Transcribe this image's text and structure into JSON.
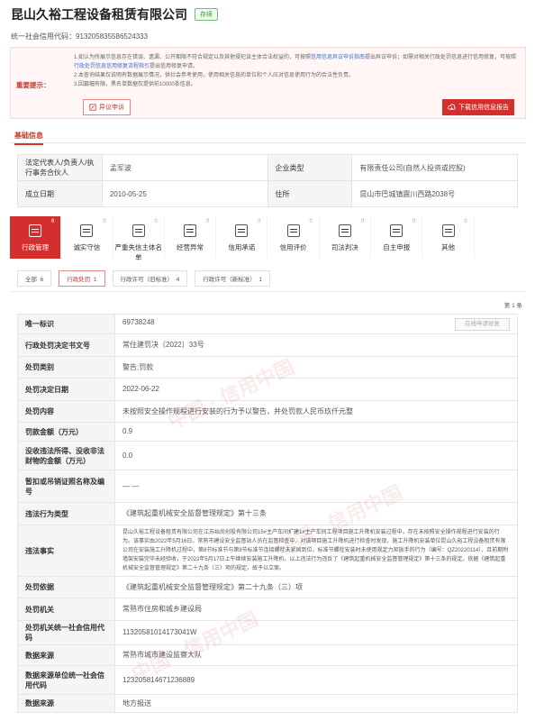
{
  "header": {
    "company_name": "昆山久裕工程设备租赁有限公司",
    "status": "存续",
    "credit_code": "统一社会信用代码：913205835586524333"
  },
  "notice": {
    "label": "重要提示：",
    "line1_a": "1.如认为所展示信息存在错误、遗漏、公开期限不符合规定以及其他侵犯该主体合法权益的，可按照",
    "line1_link1": "信用信息异议申诉指南",
    "line1_b": "提出异议申诉；如需对相关行政处罚信息进行信用修复，可按照",
    "line1_link2": "行政处罚信息信用修复流程指引",
    "line1_c": "提出信用修复申请。",
    "line2": "2.本查询结果仅说明有数据展示情况，供社会参考使用，使用相关信息的单位和个人应对信息使用行为的合法性负责。",
    "line3": "3.因篇幅有限，黑名单数据仅提供前10000条信息。",
    "objection_btn": "异议申诉",
    "download_btn": "下载信用信息报告"
  },
  "basic": {
    "tab": "基础信息",
    "legal_rep_label": "法定代表人/负责人/执行事务合伙人",
    "legal_rep_value": "孟军波",
    "type_label": "企业类型",
    "type_value": "有限责任公司(自然人投资或控股)",
    "date_label": "成立日期",
    "date_value": "2010-05-25",
    "address_label": "住所",
    "address_value": "昆山市巴城镇震川西路2038号"
  },
  "categories": [
    {
      "label": "行政管理",
      "count": "6",
      "icon": "admin-icon"
    },
    {
      "label": "诚实守信",
      "count": "0",
      "icon": "honesty-icon"
    },
    {
      "label": "严重失信主体名单",
      "count": "0",
      "icon": "blacklist-icon"
    },
    {
      "label": "经营异常",
      "count": "0",
      "icon": "alarm-icon"
    },
    {
      "label": "信用承诺",
      "count": "0",
      "icon": "promise-icon"
    },
    {
      "label": "信用评价",
      "count": "0",
      "icon": "evaluation-icon"
    },
    {
      "label": "司法判决",
      "count": "0",
      "icon": "judicial-icon"
    },
    {
      "label": "自主申报",
      "count": "0",
      "icon": "declare-icon"
    },
    {
      "label": "其他",
      "count": "0",
      "icon": "other-icon"
    }
  ],
  "subtabs": [
    {
      "label": "全部",
      "count": "6"
    },
    {
      "label": "行政处罚",
      "count": "1"
    },
    {
      "label": "行政许可（旧标准）",
      "count": "4"
    },
    {
      "label": "行政许可（新标准）",
      "count": "1"
    }
  ],
  "pager": "第 1 条",
  "online_apply": "在线申请修复",
  "detail": [
    {
      "k": "唯一标识",
      "v": "69738248"
    },
    {
      "k": "行政处罚决定书文号",
      "v": "常住建罚决〔2022〕33号"
    },
    {
      "k": "处罚类别",
      "v": "警告;罚款"
    },
    {
      "k": "处罚决定日期",
      "v": "2022-06-22"
    },
    {
      "k": "处罚内容",
      "v": "未按照安全操作规程进行安装的行为予以警告，并处罚款人民币玖仟元整"
    },
    {
      "k": "罚款金额（万元）",
      "v": "0.9"
    },
    {
      "k": "没收违法所得、没收非法财物的金额（万元）",
      "v": "0.0"
    },
    {
      "k": "暂扣或吊销证照名称及编号",
      "v": "— —"
    },
    {
      "k": "违法行为类型",
      "v": "《建筑起重机械安全监督管理规定》第十三条"
    },
    {
      "k": "违法事实",
      "v": "昆山久裕工程设备租赁有限公司在江苏始尚创投有限公司15#主产车间扩建1#主产车间工程项目施工升降机安装过程中，存在未按照安全操作规程进行安装的行为。该事实由2022年5月16日，常熟市建设安全监督站人员在监督检查中，对该项目施工升降机进行检查时发现，施工升降机安装单位昆山久裕工程设备租赁有限公司在安装施工升降机过程中，第8节标准节与第9节标准节连接螺栓未紧固到位，标准节螺栓安装时未使用规定力矩扳手的行为（编号：QZ20220114），且前期附墙架安装完毕未经验收，于2022年5月17日上午继续安装施工升降机，以上违法行为违反了《建筑起重机械安全监督管理规定》第十三条的规定。依据《建筑起重机械安全监督管理规定》第二十九条（三）项的规定，故予以立案。"
    },
    {
      "k": "处罚依据",
      "v": "《建筑起重机械安全监督管理规定》第二十九条（三）项"
    },
    {
      "k": "处罚机关",
      "v": "常熟市住房和城乡建设局"
    },
    {
      "k": "处罚机关统一社会信用代码",
      "v": "11320581014173041W"
    },
    {
      "k": "数据来源",
      "v": "常熟市城市建设监察大队"
    },
    {
      "k": "数据来源单位统一社会信用代码",
      "v": "12320581467123688​9"
    },
    {
      "k": "数据来源",
      "v": "地方报送"
    }
  ]
}
